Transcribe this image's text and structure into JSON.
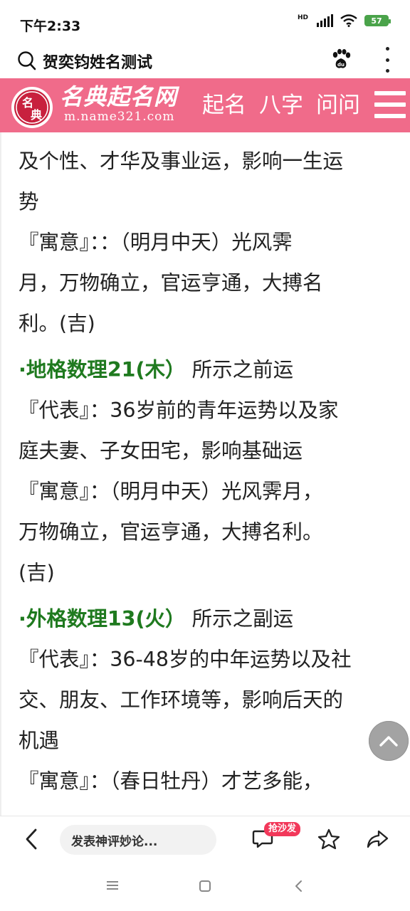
{
  "status": {
    "time": "下午2:33",
    "network_label": "HD",
    "battery": "57"
  },
  "topbar": {
    "title": "贺奕钧姓名测试"
  },
  "brand": {
    "logo_text": "名典起名网",
    "logo_url": "m.name321.com",
    "logo_seal": "名典",
    "nav": [
      "起名",
      "八字",
      "问问"
    ]
  },
  "content": {
    "lines_top": [
      "及个性、才华及事业运，影响一生运",
      "势",
      "『寓意』：：（明月中天）光风霁",
      "月，万物确立，官运亨通，大搏名",
      "利。(吉)"
    ],
    "section_di": {
      "heading_strong": "·地格数理21(木）",
      "heading_rest": "所示之前运",
      "lines": [
        "『代表』：36岁前的青年运势以及家",
        "庭夫妻、子女田宅，影响基础运",
        "『寓意』：（明月中天）光风霁月，",
        "万物确立，官运亨通，大搏名利。",
        "(吉)"
      ]
    },
    "section_wai": {
      "heading_strong": "·外格数理13(火）",
      "heading_rest": "所示之副运",
      "lines": [
        "『代表』：36-48岁的中年运势以及社",
        "交、朋友、工作环境等，影响后天的",
        "机遇",
        "『寓意』：（春日牡丹）才艺多能，"
      ]
    }
  },
  "toolbar": {
    "comment_placeholder": "发表神评妙论...",
    "badge": "抢沙发"
  },
  "colors": {
    "brand_pink": "#f06b8a",
    "heading_green": "#1f7a1f",
    "badge_red": "#f2385a"
  }
}
